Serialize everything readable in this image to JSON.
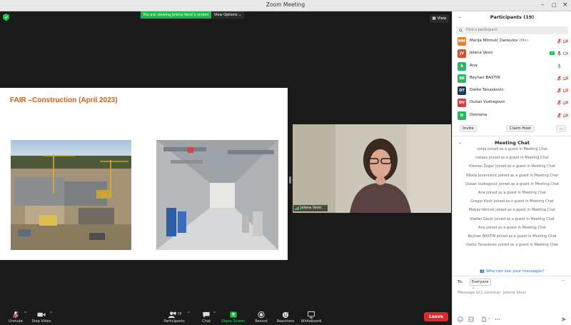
{
  "window": {
    "title": "Zoom Meeting"
  },
  "meeting": {
    "banner": "You are viewing Jelena Vesić's screen",
    "view_options": "View Options",
    "view_button": "View",
    "slide_title": "FAIR –Construction (April 2023)",
    "video_name": "Jelena Vesić"
  },
  "toolbar": {
    "unmute": "Unmute",
    "stop_video": "Stop Video",
    "participants": "Participants",
    "participants_count": "19",
    "chat": "Chat",
    "share_screen": "Share Screen",
    "record": "Record",
    "reactions": "Reactions",
    "whiteboard": "Whiteboard",
    "leave": "Leave"
  },
  "panel": {
    "participants_title": "Participants (19)",
    "search_placeholder": "Find a participant",
    "participants": [
      {
        "initials": "MM",
        "name": "Marija Mitrovic Dankulov",
        "suffix": "(Me)",
        "color": "#e8822a",
        "mic": "muted",
        "video": "off"
      },
      {
        "initials": "JV",
        "name": "Jelena Vesić",
        "suffix": "",
        "color": "#d4502a",
        "mic": "on",
        "video": "on",
        "sharing": true
      },
      {
        "initials": "A",
        "name": "Ana",
        "suffix": "",
        "color": "#2eb566",
        "mic": "on-gray",
        "video": "none"
      },
      {
        "initials": "BB",
        "name": "Beyhan BASTIN",
        "suffix": "",
        "color": "#2eb566",
        "mic": "muted",
        "video": "off"
      },
      {
        "initials": "DT",
        "name": "Darko Tanaskovic",
        "suffix": "",
        "color": "#1f3b5c",
        "mic": "muted",
        "video": "off"
      },
      {
        "initials": "DV",
        "name": "Dušan Vudragović",
        "suffix": "",
        "color": "#d44040",
        "mic": "muted",
        "video": "off"
      },
      {
        "initials": "D",
        "name": "Dzenana",
        "suffix": "",
        "color": "#2eb566",
        "mic": "muted",
        "video": "off"
      }
    ],
    "invite": "Invite",
    "claim_host": "Claim Host",
    "more": "...",
    "chat_title": "Meeting Chat",
    "chat_messages": [
      "sonja joined as a guest in Meeting Chat",
      "natasa joined as a guest in Meeting Chat",
      "Klemen Žagar joined as a guest in Meeting Chat",
      "Nikola Jovancevic joined as a guest in Meeting Chat",
      "Dušan Vudragović joined as a guest in Meeting Chat",
      "Ana joined as a guest in Meeting Chat",
      "Gregor Kosir joined as a guest in Meeting Chat",
      "Matjaz Vencelj joined as a guest in Meeting Chat",
      "Vladan Gecin joined as a guest in Meeting Chat",
      "Ana joined as a guest in Meeting Chat",
      "Beyhan BASTIN joined as a guest in Meeting Chat",
      "Darko Tanaskovic joined as a guest in Meeting Chat"
    ],
    "who_can_see": "Who can see your messages?",
    "to_label": "To:",
    "to_value": "Everyone",
    "message_placeholder": "Message SCL seminar: Jelena Vesic"
  }
}
